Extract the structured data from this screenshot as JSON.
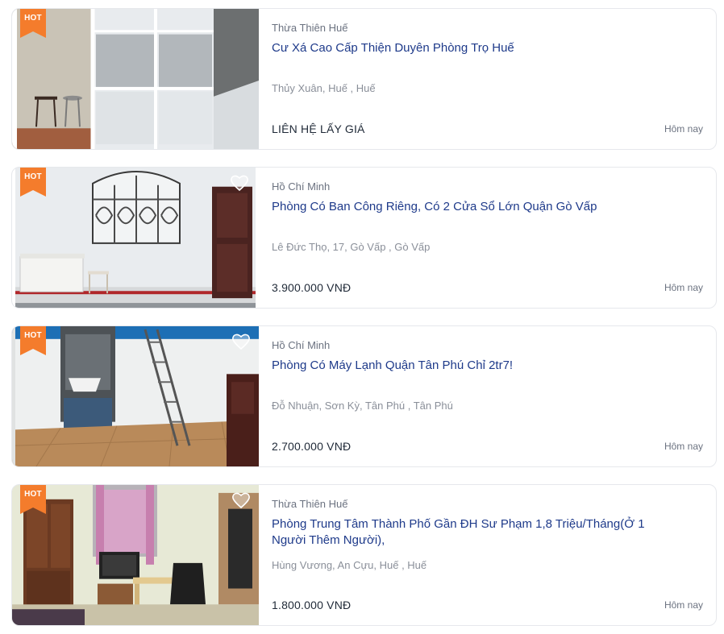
{
  "listings": [
    {
      "hot_label": "HOT",
      "region": "Thừa Thiên Huế",
      "title": "Cư Xá Cao Cấp Thiện Duyên Phòng Trọ Huế",
      "address": "Thủy Xuân, Huế , Huế",
      "price": "LIÊN HỆ LẤY GIÁ",
      "time": "Hôm nay"
    },
    {
      "hot_label": "HOT",
      "region": "Hồ Chí Minh",
      "title": "Phòng Có Ban Công Riêng, Có 2 Cửa Sổ Lớn Quận Gò Vấp",
      "address": "Lê Đức Thọ, 17, Gò Vấp , Gò Vấp",
      "price": "3.900.000 VNĐ",
      "time": "Hôm nay"
    },
    {
      "hot_label": "HOT",
      "region": "Hồ Chí Minh",
      "title": "Phòng Có Máy Lạnh Quận Tân Phú Chỉ 2tr7!",
      "address": "Đỗ Nhuận, Sơn Kỳ, Tân Phú , Tân Phú",
      "price": "2.700.000 VNĐ",
      "time": "Hôm nay"
    },
    {
      "hot_label": "HOT",
      "region": "Thừa Thiên Huế",
      "title": "Phòng Trung Tâm Thành Phố Gần ĐH Sư Phạm 1,8 Triệu/Tháng(Ở 1 Người Thêm Người),",
      "address": "Hùng Vương, An Cựu, Huế , Huế",
      "price": "1.800.000 VNĐ",
      "time": "Hôm nay"
    }
  ],
  "colors": {
    "hot_badge": "#f47c2c",
    "title": "#1e3a8a",
    "border": "#e6e8ec"
  },
  "icons": {
    "hot": "hot-ribbon-icon",
    "favorite": "heart-icon"
  }
}
